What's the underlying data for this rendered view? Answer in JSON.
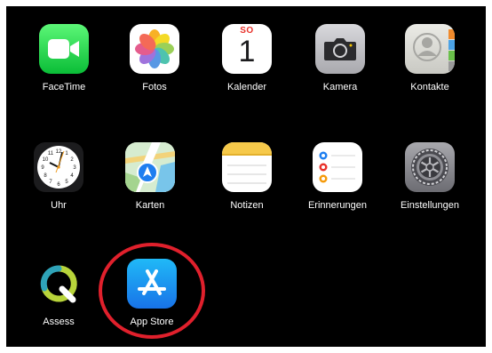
{
  "apps": [
    {
      "label": "FaceTime",
      "icon": "facetime-icon"
    },
    {
      "label": "Fotos",
      "icon": "photos-icon"
    },
    {
      "label": "Kalender",
      "icon": "calendar-icon",
      "weekday": "SO",
      "day": "1"
    },
    {
      "label": "Kamera",
      "icon": "camera-icon"
    },
    {
      "label": "Kontakte",
      "icon": "contacts-icon"
    },
    {
      "label": "Uhr",
      "icon": "clock-icon"
    },
    {
      "label": "Karten",
      "icon": "maps-icon"
    },
    {
      "label": "Notizen",
      "icon": "notes-icon"
    },
    {
      "label": "Erinnerungen",
      "icon": "reminders-icon"
    },
    {
      "label": "Einstellungen",
      "icon": "settings-icon"
    },
    {
      "label": "Assess",
      "icon": "assess-icon"
    },
    {
      "label": "App Store",
      "icon": "app-store-icon"
    }
  ],
  "highlight": {
    "target": "App Store",
    "color": "#e0202c"
  },
  "colors": {
    "background": "#000000",
    "label": "#ffffff"
  }
}
